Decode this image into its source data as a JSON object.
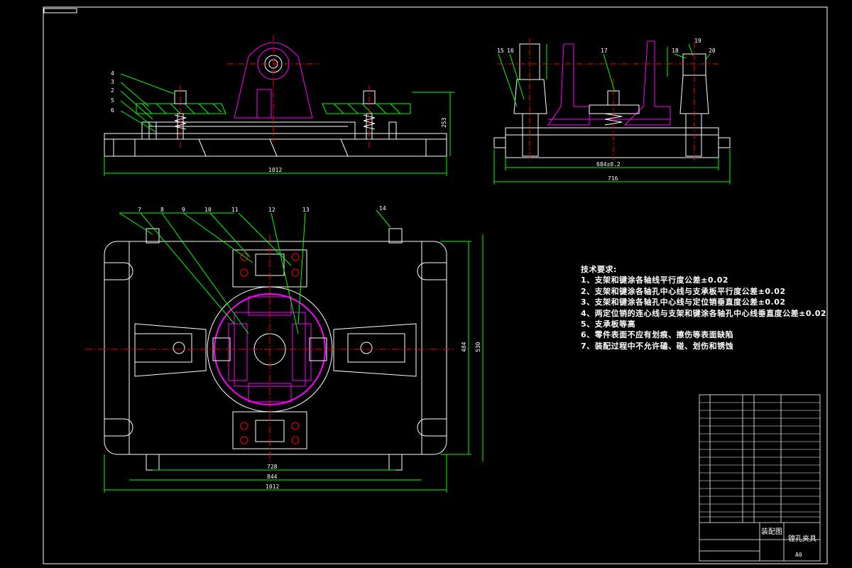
{
  "drawing": {
    "colors": {
      "background": "#000000",
      "outline": "#ffffff",
      "dimension": "#00ff00",
      "centerline": "#ff0000",
      "part": "#ff00ff",
      "leader": "#00ff00"
    },
    "front_view": {
      "balloons": [
        "4",
        "3",
        "2",
        "5",
        "6"
      ],
      "dims": {
        "overall_width": "1012",
        "height": "253"
      }
    },
    "side_view": {
      "balloons": [
        "15",
        "16",
        "17",
        "18",
        "19",
        "20"
      ],
      "dims": {
        "inner_width": "684±0.2",
        "overall_width": "716"
      }
    },
    "plan_view": {
      "balloons": [
        "7",
        "8",
        "9",
        "10",
        "11",
        "12",
        "13",
        "14"
      ],
      "dims": {
        "hole_spacing": "728",
        "inner_width": "844",
        "overall_width": "1012",
        "inner_height": "484",
        "overall_height": "530"
      }
    },
    "tech_requirements": {
      "title": "技术要求:",
      "items": [
        "1、支架和键涂各轴线平行度公差±0.02",
        "2、支架和键涂各轴孔中心线与支承板平行度公差±0.02",
        "3、支架和键涂各轴孔中心线与定位销垂直度公差±0.02",
        "4、两定位销的连心线与支架和键涂各轴孔中心线垂直度公差±0.02",
        "5、支承板等高",
        "6、零件表面不应有划痕、擦伤等表面缺陷",
        "7、装配过程中不允许磕、碰、划伤和锈蚀"
      ]
    },
    "title_block": {
      "drawing_name": "装配图",
      "part_name": "镗孔夹具",
      "sheet_size": "A0"
    }
  }
}
